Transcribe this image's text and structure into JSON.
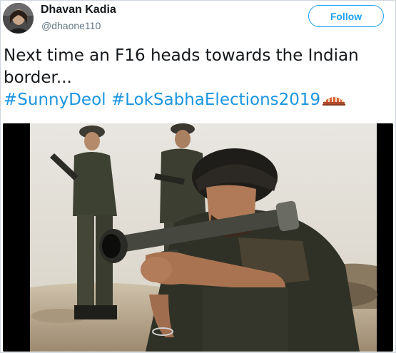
{
  "user": {
    "display_name": "Dhavan Kadia",
    "handle": "@dhaone110"
  },
  "follow_button": {
    "label": "Follow"
  },
  "tweet": {
    "line1": "Next time an F16 heads towards the Indian",
    "line2": "border...",
    "hashtag1": "#SunnyDeol",
    "hashtag2": "#LokSabhaElections2019"
  },
  "colors": {
    "link": "#1b95e0",
    "follow": "#1da1f2",
    "text": "#14171a",
    "muted": "#657786"
  }
}
